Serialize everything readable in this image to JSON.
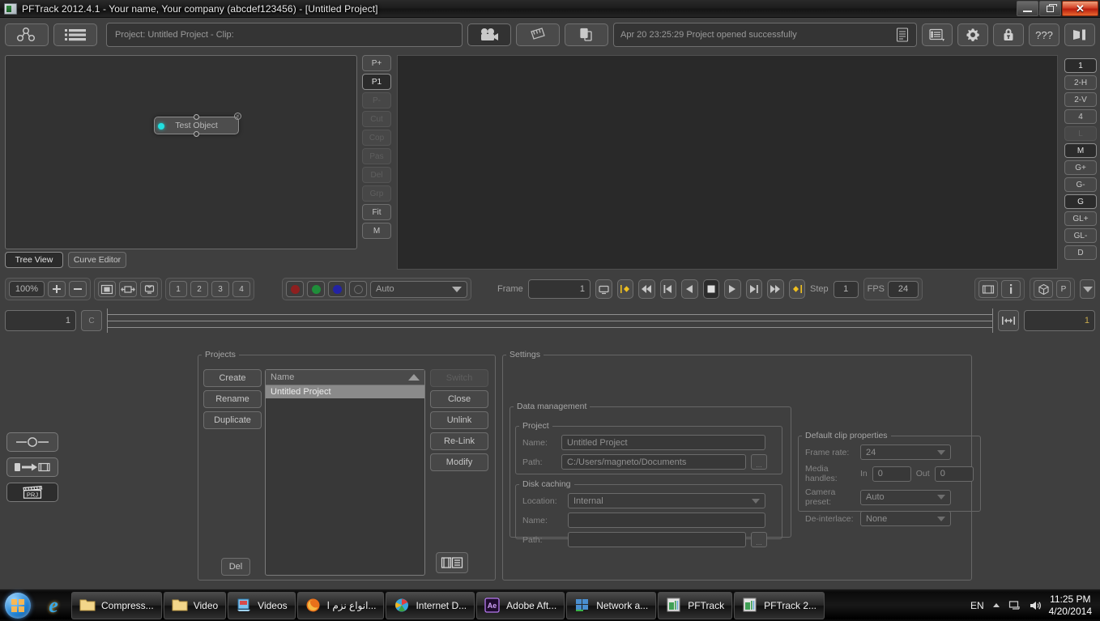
{
  "window": {
    "title": "PFTrack 2012.4.1 - Your name, Your company (abcdef123456) - [Untitled Project]",
    "minimize_label": "–",
    "restore_label": "❐",
    "close_label": "✕"
  },
  "toolbar": {
    "tree_icon": "node-tree-icon",
    "list_icon": "list-view-icon",
    "project_title": "Project: Untitled Project - Clip:",
    "camera_icon": "camera-icon",
    "clapper_icon": "clapperboard-icon",
    "copy_icon": "duplicate-files-icon",
    "status_message": "Apr 20 23:25:29 Project opened successfully",
    "status_log_icon": "log-lines-icon",
    "menu_icon": "list-menu-icon",
    "settings_icon": "gear-icon",
    "lock_icon": "lock-icon",
    "help_label": "???",
    "exit_icon": "exit-icon"
  },
  "node_editor": {
    "node_label": "Test Object",
    "side_buttons": [
      {
        "label": "P+",
        "state": "normal"
      },
      {
        "label": "P1",
        "state": "active"
      },
      {
        "label": "P-",
        "state": "disabled"
      },
      {
        "label": "Cut",
        "state": "disabled"
      },
      {
        "label": "Cop",
        "state": "disabled"
      },
      {
        "label": "Pas",
        "state": "disabled"
      },
      {
        "label": "Del",
        "state": "disabled"
      },
      {
        "label": "Grp",
        "state": "disabled"
      },
      {
        "label": "Fit",
        "state": "normal"
      },
      {
        "label": "M",
        "state": "normal"
      }
    ],
    "tabs": [
      {
        "label": "Tree View",
        "state": "active"
      },
      {
        "label": "Curve Editor",
        "state": "normal"
      }
    ]
  },
  "viewport": {
    "layout_buttons": [
      {
        "label": "1",
        "state": "active"
      },
      {
        "label": "2-H",
        "state": "normal"
      },
      {
        "label": "2-V",
        "state": "normal"
      },
      {
        "label": "4",
        "state": "normal"
      },
      {
        "label": "L",
        "state": "disabled"
      },
      {
        "label": "M",
        "state": "active"
      },
      {
        "label": "G+",
        "state": "normal"
      },
      {
        "label": "G-",
        "state": "normal"
      },
      {
        "label": "G",
        "state": "active"
      },
      {
        "label": "GL+",
        "state": "normal"
      },
      {
        "label": "GL-",
        "state": "normal"
      },
      {
        "label": "D",
        "state": "normal"
      }
    ]
  },
  "controls": {
    "zoom_value": "100%",
    "zoom_in_label": "+",
    "zoom_out_label": "–",
    "fit_icon": "fit-to-window-icon",
    "fit_width_icon": "fit-width-icon",
    "monitor_icon": "monitor-icon",
    "view_buttons": [
      "1",
      "2",
      "3",
      "4"
    ],
    "channels": [
      {
        "name": "red-channel",
        "color": "#8e1f1f"
      },
      {
        "name": "green-channel",
        "color": "#1f8e3a"
      },
      {
        "name": "blue-channel",
        "color": "#2323a5"
      },
      {
        "name": "alpha-channel",
        "color": "#3d3d3d"
      }
    ],
    "color_mode": "Auto",
    "frame_label": "Frame",
    "frame_value": "1",
    "step_label": "Step",
    "step_value": "1",
    "fps_label": "FPS",
    "fps_value": "24",
    "transport": [
      "screen-icon",
      "key-prev-icon",
      "rewind-icon",
      "step-back-icon",
      "play-reverse-icon",
      "stop-icon",
      "play-icon",
      "step-forward-icon",
      "fast-forward-icon",
      "key-next-icon"
    ],
    "film_icon": "film-strip-icon",
    "info_icon": "info-icon",
    "cube_icon": "cube-icon",
    "photo_label": "P",
    "dropdown_icon": "triangle-down-icon"
  },
  "timeline": {
    "in_value": "1",
    "cycle_label": "C",
    "range_icon": "range-fit-icon",
    "out_value": "1"
  },
  "left_rail": [
    {
      "name": "slider-tool",
      "state": "normal"
    },
    {
      "name": "import-clip-tool",
      "state": "normal"
    },
    {
      "name": "project-tool",
      "state": "active"
    }
  ],
  "projects": {
    "legend": "Projects",
    "create_label": "Create",
    "rename_label": "Rename",
    "duplicate_label": "Duplicate",
    "delete_label": "Del",
    "column_header": "Name",
    "rows": [
      "Untitled Project"
    ],
    "switch_label": "Switch",
    "close_label": "Close",
    "unlink_label": "Unlink",
    "relink_label": "Re-Link",
    "modify_label": "Modify",
    "browse_icon": "project-browse-icon"
  },
  "settings": {
    "legend": "Settings",
    "data_management": {
      "legend": "Data management",
      "project": {
        "legend": "Project",
        "name_label": "Name:",
        "name_value": "Untitled Project",
        "path_label": "Path:",
        "path_value": "C:/Users/magneto/Documents",
        "browse_label": "..."
      },
      "disk_caching": {
        "legend": "Disk caching",
        "location_label": "Location:",
        "location_value": "Internal",
        "name_label": "Name:",
        "name_value": "",
        "path_label": "Path:",
        "path_value": "",
        "browse_label": "..."
      }
    },
    "clip_properties": {
      "legend": "Default clip properties",
      "frame_rate_label": "Frame rate:",
      "frame_rate_value": "24",
      "media_handles_label": "Media handles:",
      "in_label": "In",
      "in_value": "0",
      "out_label": "Out",
      "out_value": "0",
      "camera_preset_label": "Camera preset:",
      "camera_preset_value": "Auto",
      "deinterlace_label": "De-interlace:",
      "deinterlace_value": "None"
    }
  },
  "taskbar": {
    "start_icon": "windows-start-orb",
    "ie_icon": "internet-explorer-icon",
    "items": [
      {
        "label": "Compress...",
        "icon": "folder-icon"
      },
      {
        "label": "Video",
        "icon": "folder-icon"
      },
      {
        "label": "Videos",
        "icon": "videos-library-icon"
      },
      {
        "label": "انواع نزم ا...",
        "icon": "firefox-icon"
      },
      {
        "label": "Internet D...",
        "icon": "idm-icon"
      },
      {
        "label": "Adobe Aft...",
        "icon": "after-effects-icon"
      },
      {
        "label": "Network a...",
        "icon": "network-icon"
      },
      {
        "label": "PFTrack",
        "icon": "pftrack-icon"
      },
      {
        "label": "PFTrack 2...",
        "icon": "pftrack-icon"
      }
    ],
    "language": "EN",
    "tray_up_icon": "show-hidden-icons",
    "tray_network_icon": "network-tray-icon",
    "tray_volume_icon": "volume-icon",
    "time": "11:25 PM",
    "date": "4/20/2014"
  }
}
